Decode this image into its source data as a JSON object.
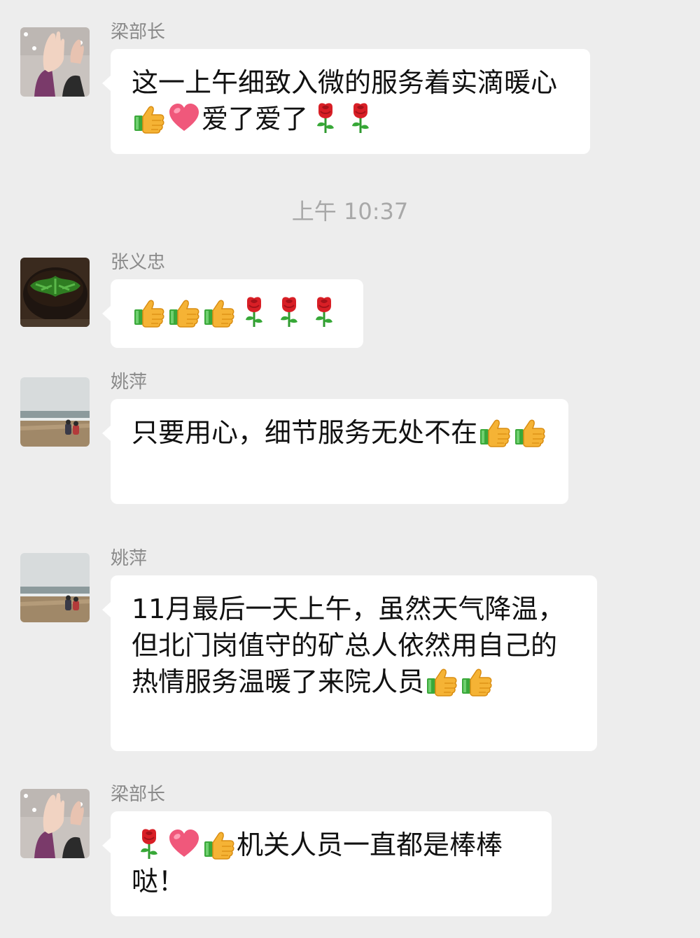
{
  "timestamp": "上午 10:37",
  "messages": [
    {
      "sender": "梁部长",
      "avatar_icon": "hands-photo-avatar",
      "parts": [
        {
          "t": "text",
          "v": "这一上午细致入微的服务着实滴暖心"
        },
        {
          "t": "emoji",
          "name": "thumbs-up-icon"
        },
        {
          "t": "emoji",
          "name": "heart-icon"
        },
        {
          "t": "text",
          "v": "爱了爱了"
        },
        {
          "t": "emoji",
          "name": "rose-icon"
        },
        {
          "t": "emoji",
          "name": "rose-icon"
        }
      ]
    },
    {
      "sender": "张义忠",
      "avatar_icon": "food-bowl-avatar",
      "parts": [
        {
          "t": "emoji",
          "name": "thumbs-up-icon"
        },
        {
          "t": "emoji",
          "name": "thumbs-up-icon"
        },
        {
          "t": "emoji",
          "name": "thumbs-up-icon"
        },
        {
          "t": "emoji",
          "name": "rose-icon"
        },
        {
          "t": "emoji",
          "name": "rose-icon"
        },
        {
          "t": "emoji",
          "name": "rose-icon"
        }
      ]
    },
    {
      "sender": "姚萍",
      "avatar_icon": "beach-photo-avatar",
      "parts": [
        {
          "t": "text",
          "v": "只要用心，细节服务无处不在"
        },
        {
          "t": "emoji",
          "name": "thumbs-up-icon"
        },
        {
          "t": "emoji",
          "name": "thumbs-up-icon"
        }
      ]
    },
    {
      "sender": "姚萍",
      "avatar_icon": "beach-photo-avatar",
      "parts": [
        {
          "t": "text",
          "v": "11月最后一天上午，虽然天气降温，但北门岗值守的矿总人依然用自己的热情服务温暖了来院人员"
        },
        {
          "t": "emoji",
          "name": "thumbs-up-icon"
        },
        {
          "t": "emoji",
          "name": "thumbs-up-icon"
        }
      ]
    },
    {
      "sender": "梁部长",
      "avatar_icon": "hands-photo-avatar",
      "parts": [
        {
          "t": "emoji",
          "name": "rose-icon"
        },
        {
          "t": "emoji",
          "name": "heart-icon"
        },
        {
          "t": "emoji",
          "name": "thumbs-up-icon"
        },
        {
          "t": "text",
          "v": "机关人员一直都是棒棒哒！"
        }
      ]
    }
  ]
}
